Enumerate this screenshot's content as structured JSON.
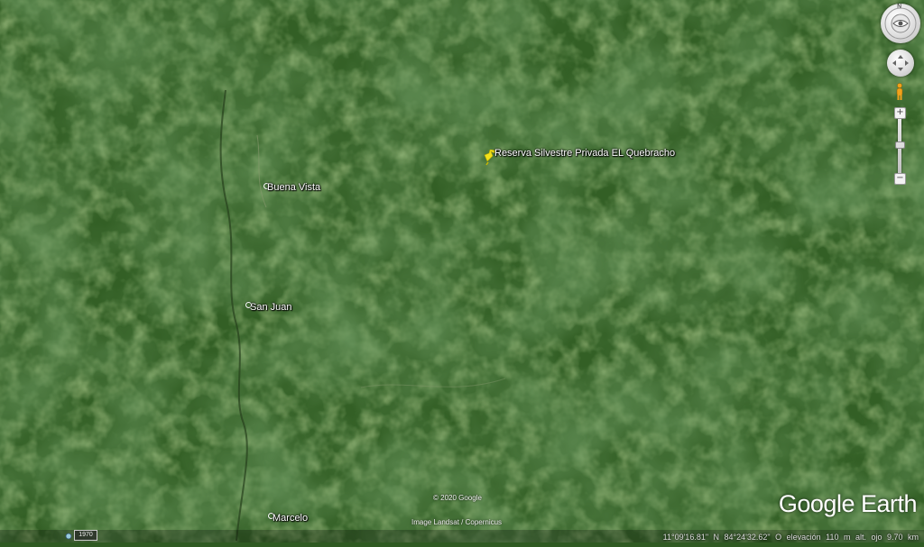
{
  "map": {
    "places": [
      {
        "name": "Reserva Silvestre Privada EL Quebracho",
        "kind": "pushpin"
      },
      {
        "name": "Buena Vista",
        "kind": "village"
      },
      {
        "name": "San Juan",
        "kind": "village"
      },
      {
        "name": "Marcelo",
        "kind": "village"
      }
    ]
  },
  "credits": {
    "copyright": "© 2020 Google",
    "imagery": "Image Landsat / Copernicus",
    "logo": "Google Earth"
  },
  "status": {
    "year": "1970",
    "text": "11°09'16.81\" N   84°24'32.62\" O   elevación   110 m     alt. ojo   9.70 km"
  },
  "controls": {
    "north_label": "N",
    "zoom_in": "+",
    "zoom_out": "−"
  },
  "colors": {
    "pushpin": "#f2e11a",
    "forest_dark": "#214b1b",
    "forest_light": "#4f7f32"
  }
}
